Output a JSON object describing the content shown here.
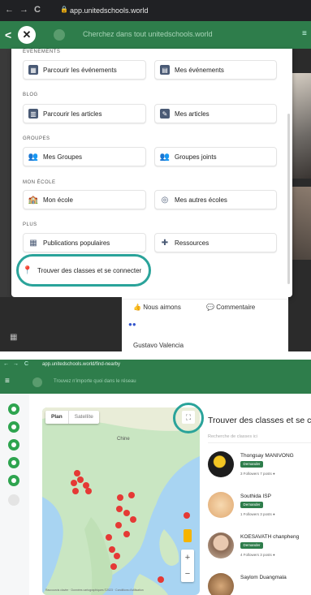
{
  "top": {
    "browser": {
      "url": "app.unitedschools.world",
      "nav_back": "←",
      "nav_fwd": "→",
      "reload": "C",
      "lock": "🔒"
    },
    "header": {
      "back_icon": "<",
      "close_icon": "✕",
      "search_placeholder": "Cherchez dans tout unitedschools.world",
      "more_icon": "≡"
    },
    "menu": {
      "sections": [
        {
          "title": "ÉVÉNEMENTS",
          "items": [
            {
              "label": "Parcourir les événements",
              "icon": "calendar-icon"
            },
            {
              "label": "Mes événements",
              "icon": "calendar-check-icon"
            }
          ]
        },
        {
          "title": "BLOG",
          "items": [
            {
              "label": "Parcourir les articles",
              "icon": "article-icon"
            },
            {
              "label": "Mes articles",
              "icon": "my-article-icon"
            }
          ]
        },
        {
          "title": "GROUPES",
          "items": [
            {
              "label": "Mes Groupes",
              "icon": "groups-icon"
            },
            {
              "label": "Groupes joints",
              "icon": "groups-joined-icon"
            }
          ]
        },
        {
          "title": "MON ÉCOLE",
          "items": [
            {
              "label": "Mon école",
              "icon": "school-icon"
            },
            {
              "label": "Mes autres écoles",
              "icon": "check-circle-icon"
            }
          ]
        },
        {
          "title": "PLUS",
          "items": [
            {
              "label": "Publications populaires",
              "icon": "grid-icon"
            },
            {
              "label": "Ressources",
              "icon": "puzzle-icon"
            }
          ]
        }
      ],
      "highlight_item": {
        "label": "Trouver des classes et se connecter",
        "icon": "map-pin-icon"
      }
    },
    "post": {
      "like_label": "Nous aimons",
      "comment_label": "Commentaire",
      "commenter": "Gustavo Valencia",
      "reactions": "●●"
    }
  },
  "bottom": {
    "browser": {
      "url": "app.unitedschools.world/find-nearby"
    },
    "header": {
      "search_placeholder": "Trouvez n'importe quoi dans le réseau"
    },
    "map": {
      "tab_map": "Plan",
      "tab_sat": "Satellite",
      "label_china": "Chine",
      "attribution": "Raccourcis clavier · Données cartographiques ©2023 · Conditions d'utilisation"
    },
    "results": {
      "title": "Trouver des classes et se co",
      "search_placeholder": "Recherche de classes ici",
      "cards": [
        {
          "name": "Thongsay MANIVONG",
          "button": "Demander",
          "stats": "3 Followers   7 posts   ●"
        },
        {
          "name": "Southida ISP",
          "button": "Demander",
          "stats": "1 Followers   3 posts   ●"
        },
        {
          "name": "KOESAVATH chanpheng",
          "button": "Demander",
          "stats": "4 Followers   3 posts   ●"
        },
        {
          "name": "Saylom Duangmala",
          "button": "",
          "stats": ""
        }
      ]
    }
  },
  "colors": {
    "green": "#2e7d4b",
    "teal_ring": "#2aa39a",
    "pin_red": "#e53935"
  }
}
